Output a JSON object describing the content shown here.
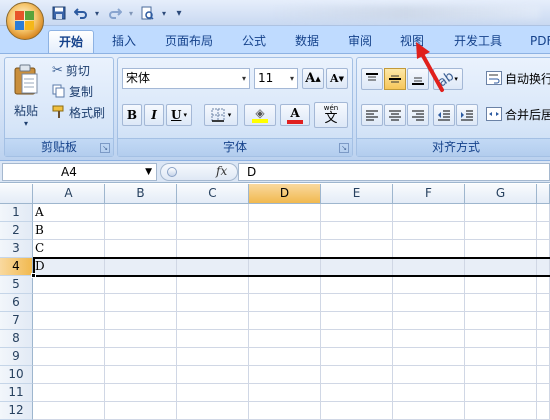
{
  "ribbon_tabs": [
    {
      "label": "开始",
      "active": true
    },
    {
      "label": "插入"
    },
    {
      "label": "页面布局"
    },
    {
      "label": "公式"
    },
    {
      "label": "数据"
    },
    {
      "label": "审阅"
    },
    {
      "label": "视图"
    },
    {
      "label": "开发工具"
    },
    {
      "label": "PDF"
    }
  ],
  "clipboard": {
    "paste_label": "粘贴",
    "cut_label": "剪切",
    "copy_label": "复制",
    "format_painter_label": "格式刷",
    "group_label": "剪贴板"
  },
  "font": {
    "font_name": "宋体",
    "font_size": "11",
    "grow_label": "A",
    "shrink_label": "A",
    "bold_label": "B",
    "italic_label": "I",
    "underline_label": "U",
    "font_color_label": "A",
    "phonetic_label": "文",
    "phonetic_top": "wén",
    "group_label": "字体"
  },
  "alignment": {
    "wrap_text_label": "自动换行",
    "merge_label": "合并后居",
    "group_label": "对齐方式"
  },
  "formula_bar": {
    "name_box": "A4",
    "fx_label": "fx",
    "formula_value": "D"
  },
  "sheet": {
    "columns": [
      "A",
      "B",
      "C",
      "D",
      "E",
      "F",
      "G"
    ],
    "rows": [
      "1",
      "2",
      "3",
      "4",
      "5",
      "6",
      "7",
      "8",
      "9",
      "10",
      "11",
      "12"
    ],
    "cells": {
      "A1": "A",
      "A2": "B",
      "A3": "C",
      "A4": "D"
    },
    "selected_cell": "A4",
    "selected_row": "4",
    "selected_column": "D"
  },
  "colors": {
    "accent": "#15428b",
    "annotation_arrow": "#e0201c",
    "font_color_bar": "#e02020",
    "highlight_bar": "#ffff00"
  }
}
